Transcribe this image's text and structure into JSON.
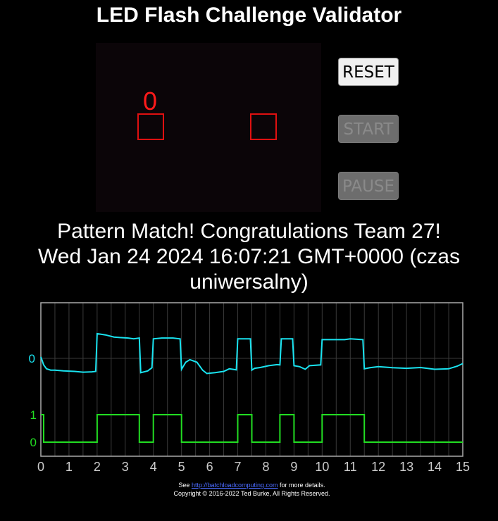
{
  "title": "LED Flash Challenge Validator",
  "led_panel": {
    "counter": "0",
    "led_color": "#e01010"
  },
  "buttons": {
    "reset": "RESET",
    "start": "START",
    "pause": "PAUSE"
  },
  "status": {
    "line1": "Pattern Match! Congratulations Team 27!",
    "line2": "Wed Jan 24 2024 16:07:21 GMT+0000 (czas",
    "line3": "uniwersalny)"
  },
  "footer": {
    "see": "See",
    "link": "http://batchloadcomputing.com",
    "details": "for more details.",
    "copyright": "Copyright © 2016-2022 Ted Burke, All Rights Reserved."
  },
  "chart_data": {
    "type": "line",
    "x_ticks": [
      "0",
      "1",
      "2",
      "3",
      "4",
      "5",
      "6",
      "7",
      "8",
      "9",
      "10",
      "11",
      "12",
      "13",
      "14",
      "15"
    ],
    "xlim": [
      0,
      15
    ],
    "grid": true,
    "colors": {
      "analog": "#19e3f0",
      "digital": "#22dd22",
      "axis_text": "#cccccc"
    },
    "series": [
      {
        "label": "0",
        "points": [
          [
            0,
            0.06
          ],
          [
            0.1,
            -0.25
          ],
          [
            0.2,
            -0.4
          ],
          [
            0.35,
            -0.45
          ],
          [
            0.5,
            -0.45
          ],
          [
            0.8,
            -0.48
          ],
          [
            1.2,
            -0.5
          ],
          [
            1.5,
            -0.53
          ],
          [
            1.8,
            -0.52
          ],
          [
            1.95,
            -0.5
          ],
          [
            2.0,
            0.95
          ],
          [
            2.3,
            0.9
          ],
          [
            2.6,
            0.82
          ],
          [
            2.8,
            0.8
          ],
          [
            3.1,
            0.78
          ],
          [
            3.3,
            0.75
          ],
          [
            3.5,
            0.78
          ],
          [
            3.55,
            -0.55
          ],
          [
            3.8,
            -0.48
          ],
          [
            3.95,
            -0.36
          ],
          [
            4.0,
            0.75
          ],
          [
            4.3,
            0.78
          ],
          [
            4.7,
            0.78
          ],
          [
            4.95,
            0.75
          ],
          [
            5.0,
            -0.42
          ],
          [
            5.15,
            -0.15
          ],
          [
            5.3,
            -0.05
          ],
          [
            5.55,
            -0.15
          ],
          [
            5.75,
            -0.45
          ],
          [
            5.9,
            -0.58
          ],
          [
            6.2,
            -0.55
          ],
          [
            6.5,
            -0.5
          ],
          [
            6.7,
            -0.4
          ],
          [
            6.95,
            -0.44
          ],
          [
            7.0,
            0.75
          ],
          [
            7.2,
            0.75
          ],
          [
            7.45,
            0.75
          ],
          [
            7.5,
            -0.45
          ],
          [
            7.6,
            -0.38
          ],
          [
            7.8,
            -0.35
          ],
          [
            8.1,
            -0.28
          ],
          [
            8.4,
            -0.24
          ],
          [
            8.5,
            -0.25
          ],
          [
            8.55,
            0.75
          ],
          [
            8.8,
            0.75
          ],
          [
            8.95,
            0.75
          ],
          [
            9.0,
            -0.28
          ],
          [
            9.2,
            -0.32
          ],
          [
            9.4,
            -0.42
          ],
          [
            9.55,
            -0.28
          ],
          [
            9.95,
            -0.25
          ],
          [
            10.0,
            0.72
          ],
          [
            10.5,
            0.72
          ],
          [
            10.8,
            0.72
          ],
          [
            11.0,
            0.75
          ],
          [
            11.45,
            0.72
          ],
          [
            11.5,
            -0.4
          ],
          [
            11.7,
            -0.36
          ],
          [
            12.0,
            -0.32
          ],
          [
            12.5,
            -0.36
          ],
          [
            13.0,
            -0.38
          ],
          [
            13.5,
            -0.35
          ],
          [
            14.0,
            -0.42
          ],
          [
            14.5,
            -0.4
          ],
          [
            14.8,
            -0.3
          ],
          [
            15.0,
            -0.2
          ]
        ]
      },
      {
        "labels": [
          "1",
          "0"
        ],
        "points": [
          [
            0,
            1
          ],
          [
            0.1,
            1
          ],
          [
            0.1,
            0
          ],
          [
            2,
            0
          ],
          [
            2,
            1
          ],
          [
            3.5,
            1
          ],
          [
            3.5,
            0
          ],
          [
            4,
            0
          ],
          [
            4,
            1
          ],
          [
            5,
            1
          ],
          [
            5,
            0
          ],
          [
            7,
            0
          ],
          [
            7,
            1
          ],
          [
            7.5,
            1
          ],
          [
            7.5,
            0
          ],
          [
            8.5,
            0
          ],
          [
            8.5,
            1
          ],
          [
            9,
            1
          ],
          [
            9,
            0
          ],
          [
            10,
            0
          ],
          [
            10,
            1
          ],
          [
            11.5,
            1
          ],
          [
            11.5,
            0
          ],
          [
            15,
            0
          ]
        ]
      }
    ]
  }
}
